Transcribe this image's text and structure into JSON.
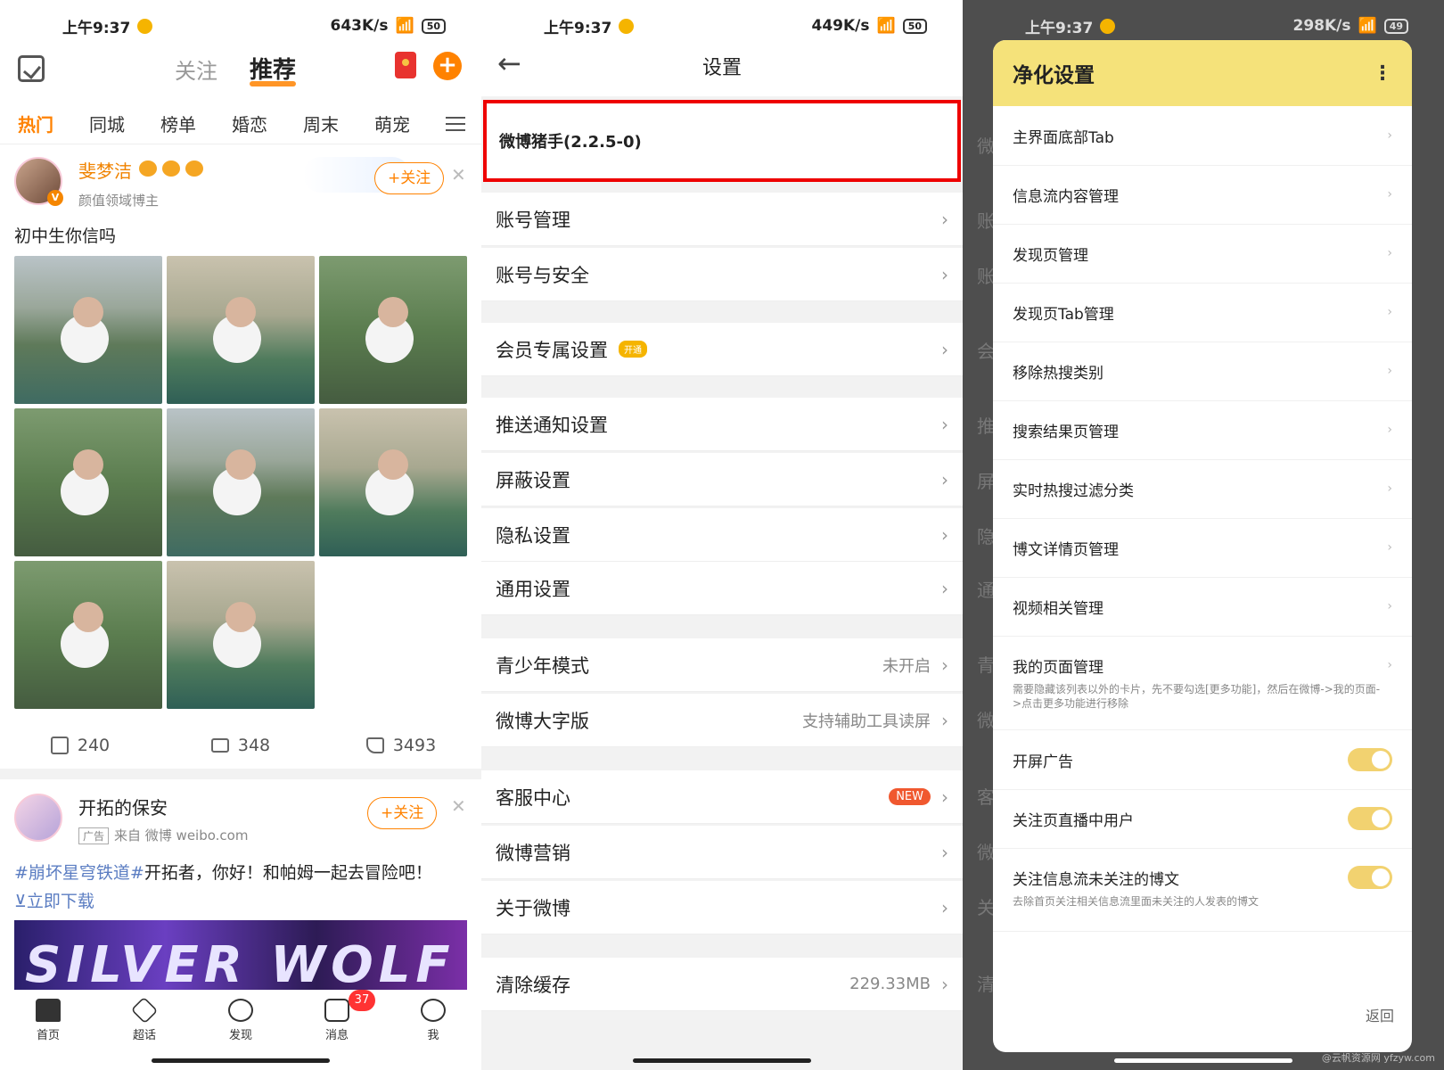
{
  "panel1": {
    "status": {
      "time": "上午9:37",
      "speed": "643K/s",
      "battery": "50"
    },
    "tabs": {
      "follow": "关注",
      "recommend": "推荐"
    },
    "categories": [
      "热门",
      "同城",
      "榜单",
      "婚恋",
      "周末",
      "萌宠"
    ],
    "post1": {
      "username": "斐梦洁",
      "subtitle": "颜值领域博主",
      "follow_label": "+关注",
      "text": "初中生你信吗",
      "images": 8,
      "shares": "240",
      "comments": "348",
      "likes": "3493"
    },
    "post2": {
      "username": "开拓的保安",
      "ad_label": "广告",
      "source": "来自 微博 weibo.com",
      "follow_label": "+关注",
      "hashtag": "#崩坏星穹铁道#",
      "text": "开拓者，你好！和帕姆一起去冒险吧！",
      "download": "⊻立即下载",
      "banner_text": "SILVER WOLF"
    },
    "nav": [
      {
        "label": "首页",
        "icon": "home-icon"
      },
      {
        "label": "超话",
        "icon": "diamond-icon"
      },
      {
        "label": "发现",
        "icon": "search-icon"
      },
      {
        "label": "消息",
        "icon": "mail-icon",
        "badge": "37"
      },
      {
        "label": "我",
        "icon": "user-icon"
      }
    ]
  },
  "panel2": {
    "status": {
      "time": "上午9:37",
      "speed": "449K/s",
      "battery": "50"
    },
    "title": "设置",
    "highlight": "微博猪手(2.2.5-0)",
    "items": [
      {
        "label": "账号管理"
      },
      {
        "label": "账号与安全"
      },
      {
        "label": "会员专属设置",
        "vip": "开通"
      },
      {
        "label": "推送通知设置"
      },
      {
        "label": "屏蔽设置"
      },
      {
        "label": "隐私设置"
      },
      {
        "label": "通用设置"
      },
      {
        "label": "青少年模式",
        "value": "未开启"
      },
      {
        "label": "微博大字版",
        "value": "支持辅助工具读屏"
      },
      {
        "label": "客服中心",
        "new": "NEW"
      },
      {
        "label": "微博营销"
      },
      {
        "label": "关于微博"
      },
      {
        "label": "清除缓存",
        "value": "229.33MB"
      }
    ]
  },
  "panel3": {
    "status": {
      "time": "上午9:37",
      "speed": "298K/s",
      "battery": "49"
    },
    "title": "净化设置",
    "items": [
      {
        "label": "主界面底部Tab"
      },
      {
        "label": "信息流内容管理"
      },
      {
        "label": "发现页管理"
      },
      {
        "label": "发现页Tab管理"
      },
      {
        "label": "移除热搜类别"
      },
      {
        "label": "搜索结果页管理"
      },
      {
        "label": "实时热搜过滤分类"
      },
      {
        "label": "博文详情页管理"
      },
      {
        "label": "视频相关管理"
      },
      {
        "label": "我的页面管理",
        "desc": "需要隐藏该列表以外的卡片，先不要勾选[更多功能]，然后在微博->我的页面->点击更多功能进行移除"
      },
      {
        "label": "开屏广告",
        "toggle": true
      },
      {
        "label": "关注页直播中用户",
        "toggle": true
      },
      {
        "label": "关注信息流未关注的博文",
        "toggle": true,
        "desc": "去除首页关注相关信息流里面未关注的人发表的博文"
      }
    ],
    "back_label": "返回",
    "watermark": "@云帆资源网 yfzyw.com",
    "bg_letters": [
      "微",
      "账",
      "账",
      "会",
      "推",
      "屏",
      "隐",
      "通",
      "青",
      "微",
      "客",
      "微",
      "关",
      "清"
    ]
  },
  "colors": {
    "accent": "#ff8200",
    "dialog_header": "#f5e27a",
    "highlight_border": "#ee0000",
    "toggle_on": "#f2d270"
  }
}
